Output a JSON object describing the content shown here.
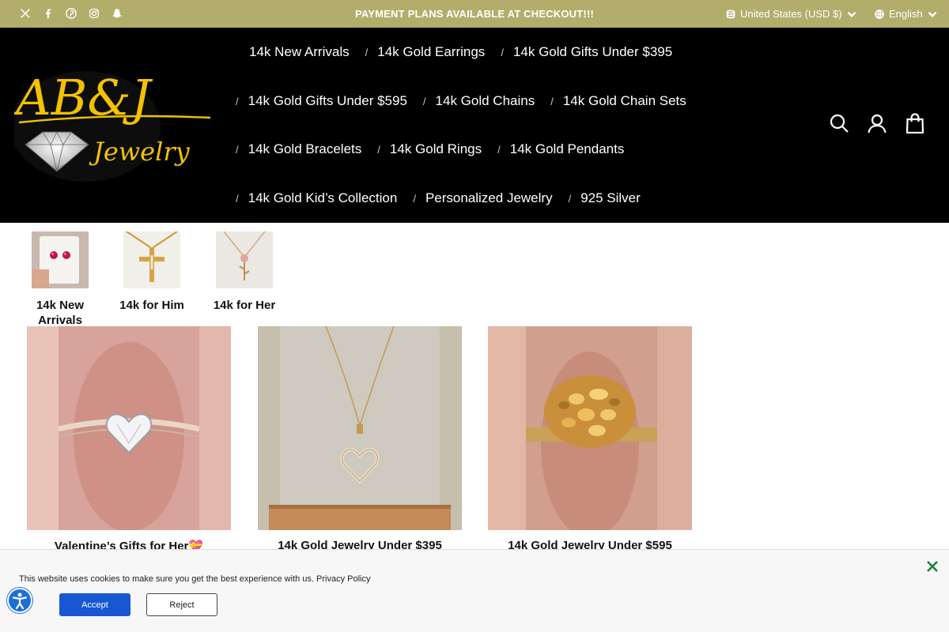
{
  "topbar": {
    "message": "PAYMENT PLANS AVAILABLE AT CHECKOUT!!!",
    "currency": "United States (USD $)",
    "language": "English",
    "socials": [
      "x-icon",
      "facebook-icon",
      "pinterest-icon",
      "instagram-icon",
      "snapchat-icon"
    ]
  },
  "brand": {
    "logo_text": "AB&J",
    "logo_sub": "Jewelry"
  },
  "nav": {
    "rows": [
      [
        "14k New Arrivals",
        "14k Gold Earrings",
        "14k Gold Gifts Under $395"
      ],
      [
        "14k Gold Gifts Under $595",
        "14k Gold Chains",
        "14k Gold Chain Sets"
      ],
      [
        "14k Gold Bracelets",
        "14k Gold Rings",
        "14k Gold Pendants"
      ],
      [
        "14k Gold Kid’s Collection",
        "Personalized Jewelry",
        "925 Silver"
      ]
    ]
  },
  "header_icons": [
    "search-icon",
    "account-icon",
    "cart-icon"
  ],
  "categories": [
    {
      "label": "14k New Arrivals"
    },
    {
      "label": "14k for Him"
    },
    {
      "label": "14k for Her"
    }
  ],
  "tiles": [
    {
      "caption": "Valentine’s Gifts for Her💝"
    },
    {
      "caption": "14k Gold Jewelry Under $395"
    },
    {
      "caption": "14k Gold Jewelry Under $595"
    }
  ],
  "cookie": {
    "text": "This website uses cookies to make sure you get the best experience with us.",
    "link": "Privacy Policy",
    "accept": "Accept",
    "reject": "Reject"
  },
  "colors": {
    "topbar": "#b3ad6c",
    "header": "#000000",
    "gold": "#f2c200",
    "accept": "#1757d4",
    "close": "#17803d"
  }
}
